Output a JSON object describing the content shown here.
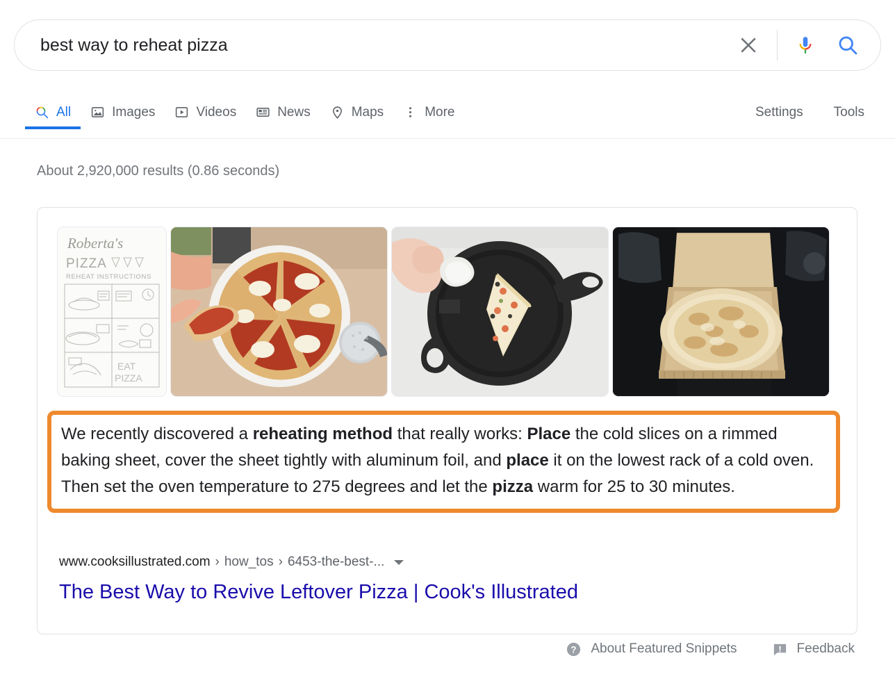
{
  "search": {
    "query": "best way to reheat pizza",
    "placeholder": "Search",
    "clear_icon": "close-icon",
    "mic_icon": "microphone-icon",
    "search_icon": "search-icon"
  },
  "tabs": [
    {
      "label": "All",
      "icon": "search-icon",
      "active": true
    },
    {
      "label": "Images",
      "icon": "image-icon",
      "active": false
    },
    {
      "label": "Videos",
      "icon": "video-icon",
      "active": false
    },
    {
      "label": "News",
      "icon": "newspaper-icon",
      "active": false
    },
    {
      "label": "Maps",
      "icon": "map-pin-icon",
      "active": false
    },
    {
      "label": "More",
      "icon": "more-vert-icon",
      "active": false
    }
  ],
  "tools": {
    "settings_label": "Settings",
    "tools_label": "Tools"
  },
  "result_stats": "About 2,920,000 results (0.86 seconds)",
  "thumbnails": [
    {
      "name": "robertas-pizza-reheat-instructions-illustration",
      "alt": "Roberta's Pizza Reheat Instructions hand-drawn comic"
    },
    {
      "name": "sliced-pizza-on-white-plate-photo",
      "alt": "Hand lifting a slice from a sliced pizza on a white plate"
    },
    {
      "name": "pizza-slice-in-cast-iron-skillet-photo",
      "alt": "Pizza slice in a black cast iron skillet with a hand holding foil"
    },
    {
      "name": "whole-pizza-in-open-box-photo",
      "alt": "Whole cheese pizza in an open cardboard delivery box"
    }
  ],
  "featured_snippet": {
    "highlight_color": "#ee8a2e",
    "paragraph": [
      {
        "text": "We recently discovered a ",
        "bold": false
      },
      {
        "text": "reheating method",
        "bold": true
      },
      {
        "text": " that really works: ",
        "bold": false
      },
      {
        "text": "Place",
        "bold": true
      },
      {
        "text": " the cold slices on a rimmed baking sheet, cover the sheet tightly with aluminum foil, and ",
        "bold": false
      },
      {
        "text": "place",
        "bold": true
      },
      {
        "text": " it on the lowest rack of a cold oven. Then set the oven temperature to 275 degrees and let the ",
        "bold": false
      },
      {
        "text": "pizza",
        "bold": true
      },
      {
        "text": " warm for 25 to 30 minutes.",
        "bold": false
      }
    ],
    "breadcrumb": {
      "domain": "www.cooksillustrated.com",
      "separator": "›",
      "crumbs": [
        "how_tos",
        "6453-the-best-..."
      ],
      "caret_icon": "chevron-down-icon"
    },
    "title": "The Best Way to Revive Leftover Pizza | Cook's Illustrated",
    "title_color": "#1a0dab"
  },
  "footer": [
    {
      "label": "About Featured Snippets",
      "icon": "help-circle-icon"
    },
    {
      "label": "Feedback",
      "icon": "feedback-bubble-icon"
    }
  ]
}
